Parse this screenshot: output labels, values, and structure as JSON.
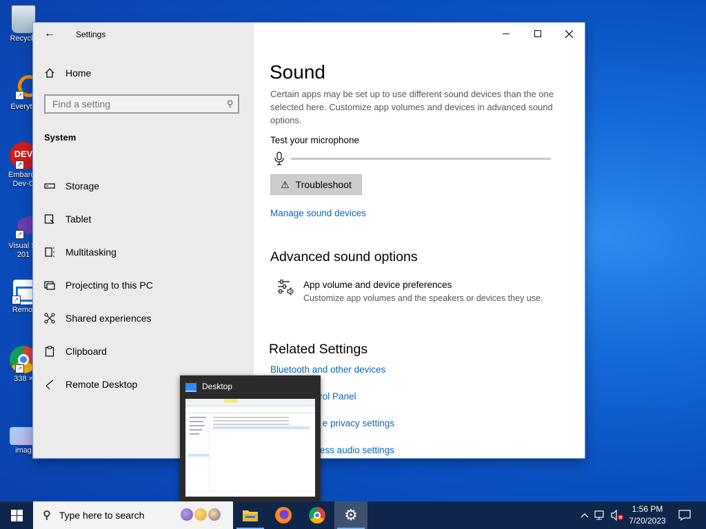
{
  "desktop": {
    "icons": [
      {
        "label": "Recycle",
        "name": "recycle-bin"
      },
      {
        "label": "Everyth",
        "name": "everything"
      },
      {
        "label": "Embarca Dev-C",
        "name": "embarcadero-devc"
      },
      {
        "label": "Visual St 201",
        "name": "visual-studio"
      },
      {
        "label": "Remot",
        "name": "remote-desktop"
      },
      {
        "label": "338 ×",
        "name": "chrome-shortcut"
      },
      {
        "label": "imag",
        "name": "image-file"
      }
    ]
  },
  "window": {
    "title": "Settings",
    "controls": {
      "minimize": "—",
      "maximize": "☐",
      "close": "✕"
    }
  },
  "sidebar": {
    "home": "Home",
    "search_placeholder": "Find a setting",
    "section": "System",
    "items": [
      {
        "label": "Storage",
        "icon": "storage-icon"
      },
      {
        "label": "Tablet",
        "icon": "tablet-icon"
      },
      {
        "label": "Multitasking",
        "icon": "multitasking-icon"
      },
      {
        "label": "Projecting to this PC",
        "icon": "projecting-icon"
      },
      {
        "label": "Shared experiences",
        "icon": "shared-experiences-icon"
      },
      {
        "label": "Clipboard",
        "icon": "clipboard-icon"
      },
      {
        "label": "Remote Desktop",
        "icon": "remote-desktop-icon"
      }
    ]
  },
  "content": {
    "title": "Sound",
    "description": "Certain apps may be set up to use different sound devices than the one selected here. Customize app volumes and devices in advanced sound options.",
    "test_mic_label": "Test your microphone",
    "mic_level": 0,
    "troubleshoot": "Troubleshoot",
    "manage_link": "Manage sound devices",
    "advanced_heading": "Advanced sound options",
    "app_volume_title": "App volume and device preferences",
    "app_volume_sub": "Customize app volumes and the speakers or devices they use.",
    "related_heading": "Related Settings",
    "related_links": [
      "Bluetooth and other devices",
      "Sound Control Panel",
      "e privacy settings",
      "cess audio settings"
    ]
  },
  "thumbnail": {
    "title": "Desktop"
  },
  "taskbar": {
    "search_placeholder": "Type here to search",
    "apps": [
      "file-explorer",
      "firefox",
      "chrome",
      "settings"
    ],
    "time": "1:56 PM",
    "date": "7/20/2023"
  },
  "colors": {
    "accent": "#0a66b8",
    "sidebar": "#ebebeb",
    "taskbar": "#10254a"
  }
}
